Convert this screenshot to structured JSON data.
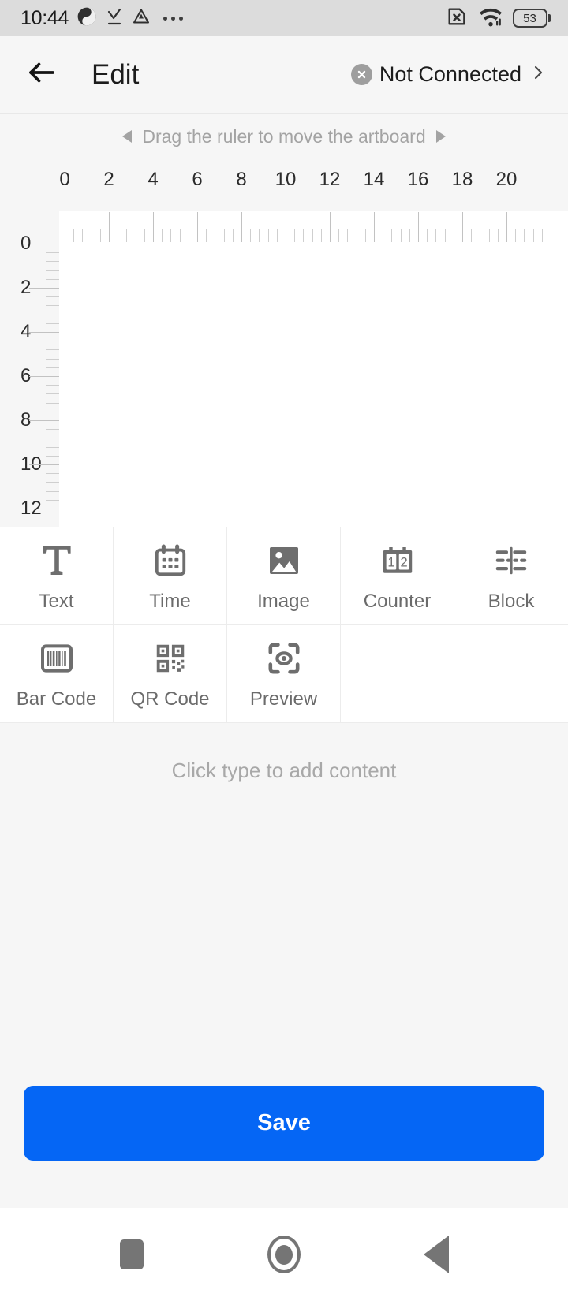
{
  "statusbar": {
    "time": "10:44",
    "icons": [
      "app-badge-icon",
      "download-check-icon",
      "triangle-warning-icon",
      "more-dots-icon"
    ],
    "sim_icon": "no-sim-icon",
    "wifi_icon": "wifi-icon",
    "battery_level": "53"
  },
  "header": {
    "back_icon": "back-arrow-icon",
    "title": "Edit",
    "connection": {
      "badge_icon": "close-circle-icon",
      "label": "Not Connected",
      "chevron_icon": "chevron-right-icon"
    }
  },
  "editor": {
    "drag_hint": "Drag the ruler to move the artboard",
    "left_arrow_icon": "triangle-left-icon",
    "right_arrow_icon": "triangle-right-icon",
    "h_ruler": {
      "labels": [
        "0",
        "2",
        "4",
        "6",
        "8",
        "10",
        "12",
        "14",
        "16",
        "18",
        "20"
      ],
      "minor_per_major": 4
    },
    "v_ruler": {
      "labels": [
        "0",
        "2",
        "4",
        "6",
        "8",
        "10",
        "12"
      ],
      "minor_per_major": 4
    }
  },
  "tools": [
    {
      "label": "Text",
      "icon": "text-icon"
    },
    {
      "label": "Time",
      "icon": "calendar-icon"
    },
    {
      "label": "Image",
      "icon": "image-icon"
    },
    {
      "label": "Counter",
      "icon": "counter-icon"
    },
    {
      "label": "Block",
      "icon": "block-align-icon"
    },
    {
      "label": "Bar Code",
      "icon": "barcode-icon"
    },
    {
      "label": "QR Code",
      "icon": "qrcode-icon"
    },
    {
      "label": "Preview",
      "icon": "preview-eye-icon"
    },
    {
      "label": "",
      "icon": ""
    },
    {
      "label": "",
      "icon": ""
    }
  ],
  "content": {
    "hint": "Click type to add content"
  },
  "footer": {
    "save_label": "Save"
  },
  "navbar": {
    "recents_icon": "square-icon",
    "home_icon": "circle-icon",
    "back_icon": "triangle-back-icon"
  },
  "colors": {
    "accent": "#0566f5",
    "statusbar_bg": "#dcdcdc",
    "page_bg": "#f6f6f6",
    "artboard": "#ffffff",
    "icon_gray": "#6e6e6e",
    "muted_text": "#a8a8a8"
  }
}
